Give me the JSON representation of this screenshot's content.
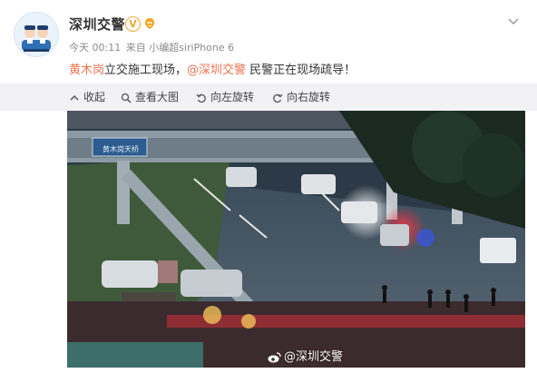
{
  "post": {
    "username": "深圳交警",
    "verified_mark": "V",
    "time": "今天 00:11",
    "source": "来自 小编超siriPhone 6",
    "content_link_location": "黄木岗",
    "content_text_1": "立交施工现场，",
    "content_mention": "@深圳交警",
    "content_text_2": " 民警正在现场疏导！"
  },
  "toolbar": {
    "collapse": "收起",
    "view_large": "查看大图",
    "rotate_left": "向左旋转",
    "rotate_right": "向右旋转"
  },
  "photo": {
    "sign_text": "黄木岗天桥",
    "watermark": "@深圳交警"
  },
  "colors": {
    "link": "#eb7350",
    "toolbar_bg": "#f2f2f5",
    "verified": "#f3a633"
  },
  "icons": [
    "avatar-police-icon",
    "verified-icon",
    "vip-badge-icon",
    "chevron-down-icon",
    "collapse-icon",
    "zoom-icon",
    "rotate-left-icon",
    "rotate-right-icon",
    "weibo-logo-icon"
  ]
}
